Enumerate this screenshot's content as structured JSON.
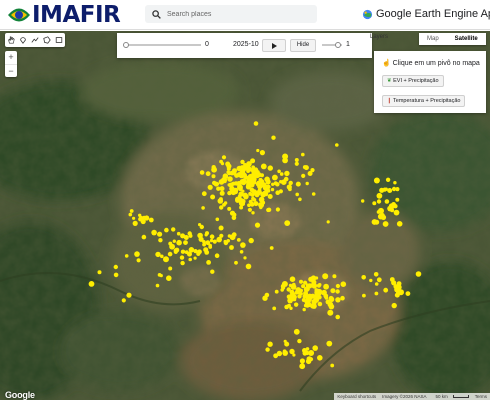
{
  "header": {
    "logo_text": "IMAFIR",
    "search_placeholder": "Search places",
    "app_title": "Google Earth Engine Apps"
  },
  "timeline": {
    "start_value": "0",
    "date": "2025-10",
    "hide_label": "Hide",
    "opacity_value": "1",
    "layers_label": "Layers"
  },
  "map_type": {
    "options": [
      "Map",
      "Satellite"
    ],
    "selected": "Satellite"
  },
  "panel": {
    "title": "Clique em um pivô no mapa",
    "button1": "EVI + Precipitação",
    "button2": "Temperatura + Precipitação"
  },
  "zoom": {
    "in": "+",
    "out": "−"
  },
  "footer": {
    "google": "Google",
    "shortcuts": "Keyboard shortcuts",
    "imagery": "Imagery ©2026 NASA",
    "scale": "50 km",
    "terms": "Terms"
  },
  "colors": {
    "pivot_points": "#ffee00",
    "logo_text": "#0d1d6b",
    "map_base": "#3d4a2e"
  },
  "icons": [
    "search-icon",
    "hand-icon",
    "marker-icon",
    "line-icon",
    "polygon-icon",
    "rectangle-icon",
    "play-icon"
  ]
}
